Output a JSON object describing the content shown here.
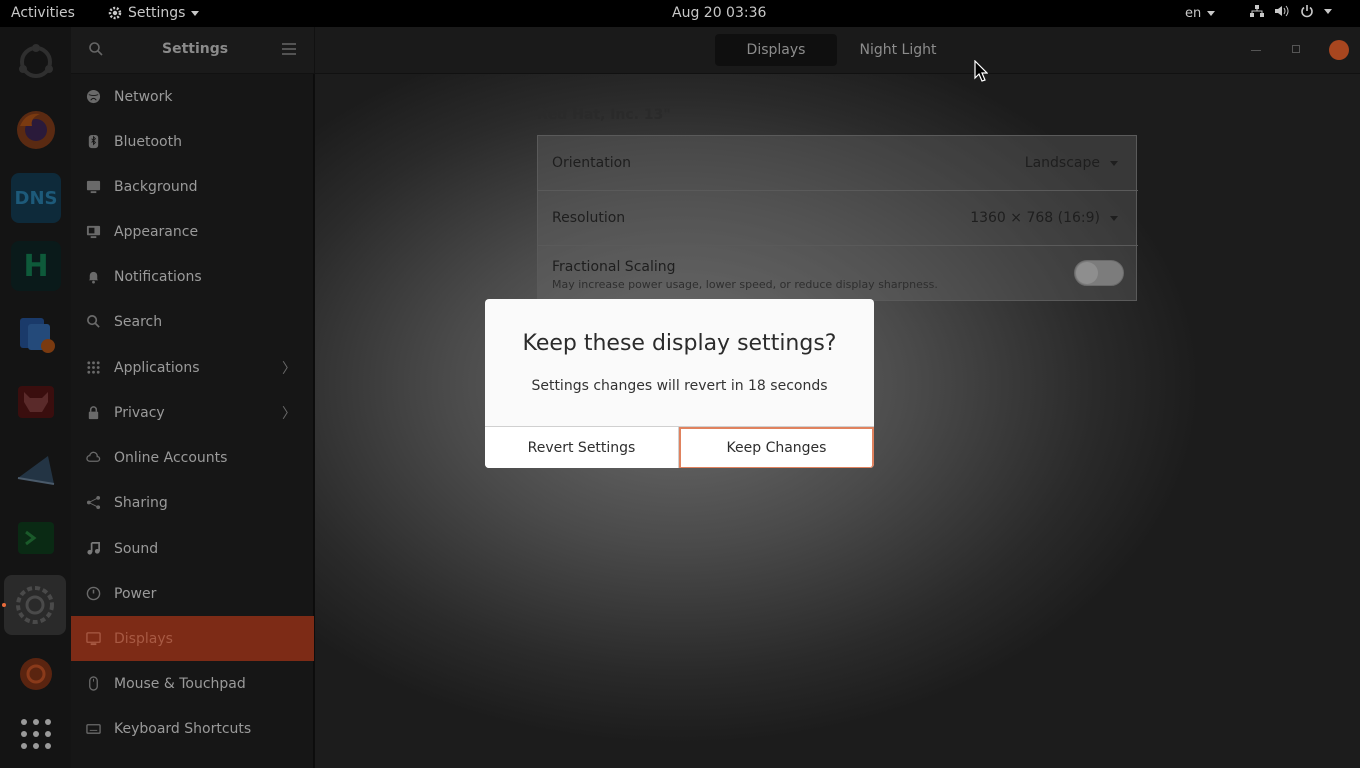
{
  "topbar": {
    "activities": "Activities",
    "app_name": "Settings",
    "clock": "Aug 20  03:36",
    "lang": "en"
  },
  "headerbar": {
    "title": "Settings",
    "tabs": [
      {
        "label": "Displays",
        "active": true
      },
      {
        "label": "Night Light",
        "active": false
      }
    ]
  },
  "sidebar": {
    "items": [
      {
        "label": "Network",
        "icon": "globe-icon"
      },
      {
        "label": "Bluetooth",
        "icon": "bluetooth-icon"
      },
      {
        "label": "Background",
        "icon": "monitor-icon"
      },
      {
        "label": "Appearance",
        "icon": "appearance-icon"
      },
      {
        "label": "Notifications",
        "icon": "bell-icon"
      },
      {
        "label": "Search",
        "icon": "search-icon"
      },
      {
        "label": "Applications",
        "icon": "grid-icon",
        "chevron": true
      },
      {
        "label": "Privacy",
        "icon": "lock-icon",
        "chevron": true
      },
      {
        "label": "Online Accounts",
        "icon": "cloud-icon"
      },
      {
        "label": "Sharing",
        "icon": "share-icon"
      },
      {
        "label": "Sound",
        "icon": "music-note-icon"
      },
      {
        "label": "Power",
        "icon": "power-icon"
      },
      {
        "label": "Displays",
        "icon": "display-icon",
        "selected": true
      },
      {
        "label": "Mouse & Touchpad",
        "icon": "mouse-icon"
      },
      {
        "label": "Keyboard Shortcuts",
        "icon": "keyboard-icon"
      }
    ]
  },
  "display": {
    "monitor_name": "Red Hat, Inc. 13\"",
    "orientation_label": "Orientation",
    "orientation_value": "Landscape",
    "resolution_label": "Resolution",
    "resolution_value": "1360 × 768 (16:9)",
    "fractional_label": "Fractional Scaling",
    "fractional_sub": "May increase power usage, lower speed, or reduce display sharpness.",
    "fractional_enabled": false
  },
  "dialog": {
    "title": "Keep these display settings?",
    "message": "Settings changes will revert in 18 seconds",
    "revert_label": "Revert Settings",
    "keep_label": "Keep Changes"
  },
  "colors": {
    "accent": "#e95420",
    "selected_row": "#7d2b16"
  }
}
